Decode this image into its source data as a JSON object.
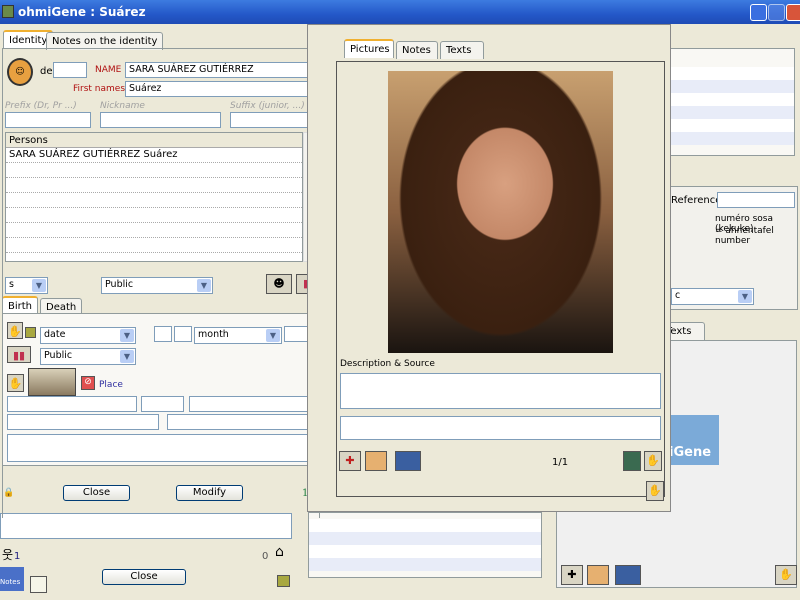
{
  "window": {
    "title": "ohmiGene : Suárez"
  },
  "identity": {
    "tabs": [
      "Identity",
      "Notes on the identity"
    ],
    "de_label": "de",
    "name_label": "NAME",
    "name_value": "SARA SUÁREZ GUTIÉRREZ",
    "first_names_label": "First names",
    "first_names_value": "Suárez",
    "prefix_label": "Prefix (Dr, Pr ...)",
    "nickname_label": "Nickname",
    "suffix_label": "Suffix (junior, ...)",
    "persons_header": "Persons",
    "persons": [
      "SARA SUÁREZ GUTIÉRREZ Suárez"
    ],
    "sex_value": "s",
    "privacy_value": "Public",
    "event_tabs": [
      "Birth",
      "Death"
    ],
    "date_type": "date",
    "month": "month",
    "event_privacy": "Public",
    "place_label": "Place",
    "close_label": "Close",
    "modify_label": "Modify",
    "count": "1"
  },
  "pictures": {
    "tabs": [
      "Pictures",
      "Notes",
      "Texts"
    ],
    "description_label": "Description & Source",
    "page": "1/1"
  },
  "background": {
    "reference_label": "Reference",
    "sosa_line1": "numéro sosa (kekuke)",
    "sosa_line2": "=  ahnentafel number",
    "select_partial": "c",
    "texts_tab": "Texts",
    "logo_text": "iGene",
    "person_count": "1",
    "house_count": "0",
    "close_label": "Close",
    "notes_label": "Notes"
  },
  "colors": {
    "titlebar": "#2458C8",
    "dialog_bg": "#ECE9D8",
    "name_label": "#B01010",
    "place_link": "#3030A0"
  }
}
